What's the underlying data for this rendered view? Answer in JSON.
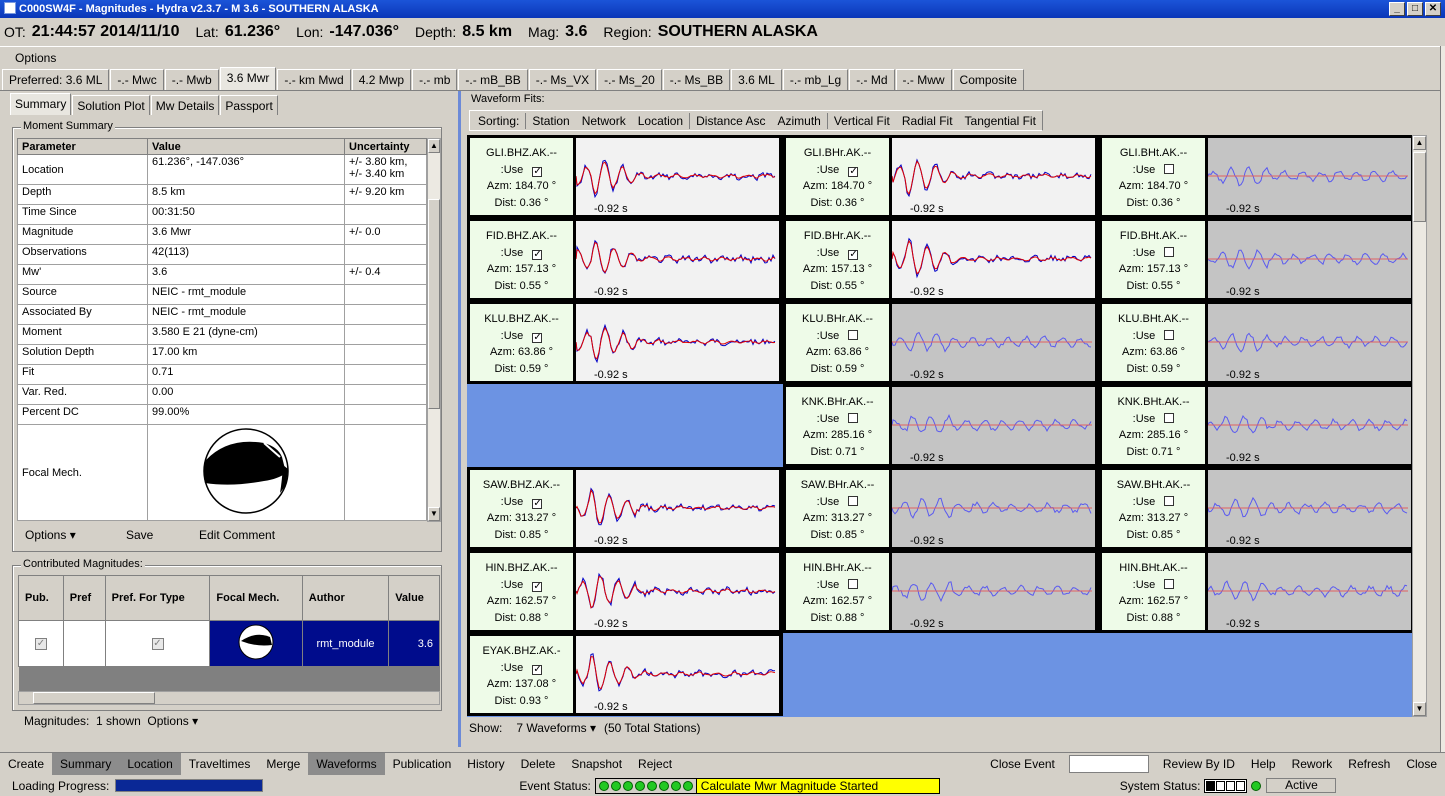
{
  "window": {
    "title": "C000SW4F - Magnitudes - Hydra v2.3.7 -  M 3.6  - SOUTHERN ALASKA"
  },
  "event": {
    "ot_label": "OT:",
    "ot": "21:44:57 2014/11/10",
    "lat_label": "Lat:",
    "lat": "61.236°",
    "lon_label": "Lon:",
    "lon": "-147.036°",
    "depth_label": "Depth:",
    "depth": "8.5 km",
    "mag_label": "Mag:",
    "mag": "3.6",
    "region_label": "Region:",
    "region": "SOUTHERN ALASKA"
  },
  "menu": {
    "options": "Options"
  },
  "mag_tabs": [
    "Preferred: 3.6 ML",
    "-.- Mwc",
    "-.- Mwb",
    "3.6 Mwr",
    "-.- km Mwd",
    "4.2 Mwp",
    "-.- mb",
    "-.- mB_BB",
    "-.- Ms_VX",
    "-.- Ms_20",
    "-.- Ms_BB",
    "3.6 ML",
    "-.- mb_Lg",
    "-.- Md",
    "-.- Mww",
    "Composite"
  ],
  "sub_tabs": [
    "Summary",
    "Solution Plot",
    "Mw Details",
    "Passport"
  ],
  "moment": {
    "title": "Moment Summary",
    "headers": [
      "Parameter",
      "Value",
      "Uncertainty"
    ],
    "rows": [
      {
        "p": "Location",
        "v": "61.236°, -147.036°",
        "u": "+/- 3.80 km,",
        "u2": "+/- 3.40 km"
      },
      {
        "p": "Depth",
        "v": "8.5 km",
        "u": "+/- 9.20 km",
        "u2": ""
      },
      {
        "p": "Time Since",
        "v": "00:31:50",
        "u": "",
        "u2": ""
      },
      {
        "p": "Magnitude",
        "v": "3.6 Mwr",
        "u": "+/- 0.0",
        "u2": ""
      },
      {
        "p": "Observations",
        "v": "42(113)",
        "u": "",
        "u2": ""
      },
      {
        "p": "Mw'",
        "v": "3.6",
        "u": "+/- 0.4",
        "u2": ""
      },
      {
        "p": "Source",
        "v": "NEIC - rmt_module",
        "u": "",
        "u2": ""
      },
      {
        "p": "Associated By",
        "v": "NEIC - rmt_module",
        "u": "",
        "u2": ""
      },
      {
        "p": "Moment",
        "v": "3.580 E 21 (dyne-cm)",
        "u": "",
        "u2": ""
      },
      {
        "p": "Solution Depth",
        "v": "17.00 km",
        "u": "",
        "u2": ""
      },
      {
        "p": "Fit",
        "v": "0.71",
        "u": "",
        "u2": ""
      },
      {
        "p": "Var. Red.",
        "v": "0.00",
        "u": "",
        "u2": ""
      },
      {
        "p": "Percent DC",
        "v": "99.00%",
        "u": "",
        "u2": ""
      }
    ],
    "focal_label": "Focal Mech.",
    "options": "Options",
    "save": "Save",
    "edit_comment": "Edit Comment"
  },
  "contrib": {
    "title": "Contributed Magnitudes:",
    "headers": [
      "Pub.",
      "Pref",
      "Pref. For Type",
      "Focal Mech.",
      "Author",
      "Value"
    ],
    "row": {
      "author": "rmt_module",
      "value": "3.6"
    },
    "footer_label": "Magnitudes:",
    "footer_count": "1 shown",
    "footer_options": "Options"
  },
  "waveform": {
    "title": "Waveform Fits:",
    "sort_label": "Sorting:",
    "sorts": [
      "Station",
      "Network",
      "Location",
      "Distance Asc",
      "Azimuth",
      "Vertical Fit",
      "Radial Fit",
      "Tangential Fit"
    ],
    "show_label": "Show:",
    "show_value": "7 Waveforms",
    "show_total": "(50 Total Stations)",
    "use_label": ":Use",
    "lag": "-0.92 s"
  },
  "bottom": {
    "buttons": [
      "Create",
      "Summary",
      "Location",
      "Traveltimes",
      "Merge",
      "Waveforms",
      "Publication",
      "History",
      "Delete",
      "Snapshot",
      "Reject"
    ],
    "active": [
      "Summary",
      "Location",
      "Waveforms"
    ],
    "right": [
      "Close Event",
      "Review By ID",
      "Help",
      "Rework",
      "Refresh",
      "Close"
    ]
  },
  "status": {
    "loading": "Loading Progress:",
    "event_status": "Event Status:",
    "event_msg": "Calculate Mwr Magnitude Started",
    "system_status": "System Status:",
    "active": "Active"
  }
}
